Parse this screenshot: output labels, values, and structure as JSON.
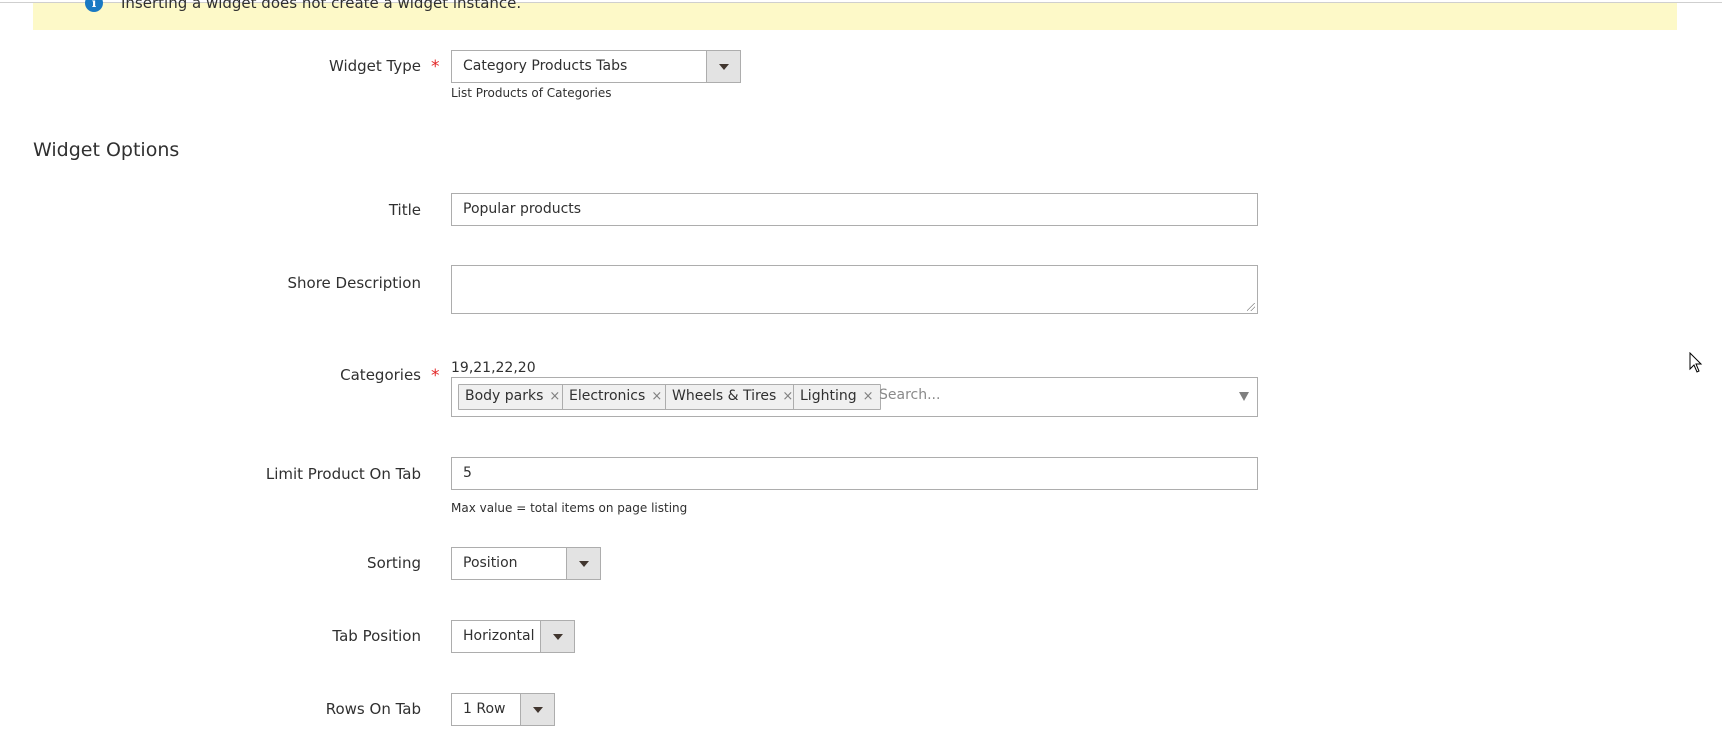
{
  "notice": {
    "icon": "info-icon",
    "text": "Inserting a widget does not create a widget instance."
  },
  "widget_type": {
    "label": "Widget Type",
    "required_mark": "*",
    "value": "Category Products Tabs",
    "hint": "List Products of Categories"
  },
  "widget_options": {
    "heading": "Widget Options",
    "title": {
      "label": "Title",
      "value": "Popular products"
    },
    "short_description": {
      "label": "Shore Description",
      "value": ""
    },
    "categories": {
      "label": "Categories",
      "required_mark": "*",
      "ids_text": "19,21,22,20",
      "chips": [
        {
          "label": "Body parks",
          "remove": "×"
        },
        {
          "label": "Electronics",
          "remove": "×"
        },
        {
          "label": "Wheels & Tires",
          "remove": "×"
        },
        {
          "label": "Lighting",
          "remove": "×"
        }
      ],
      "search_placeholder": "Search..."
    },
    "limit_product": {
      "label": "Limit Product On Tab",
      "value": "5",
      "hint": "Max value = total items on page listing"
    },
    "sorting": {
      "label": "Sorting",
      "value": "Position"
    },
    "tab_position": {
      "label": "Tab Position",
      "value": "Horizontal"
    },
    "rows_on_tab": {
      "label": "Rows On Tab",
      "value": "1 Row"
    }
  },
  "colors": {
    "notice_bg": "#fdf9c8",
    "required": "#e22626",
    "info_icon": "#1979c3"
  }
}
